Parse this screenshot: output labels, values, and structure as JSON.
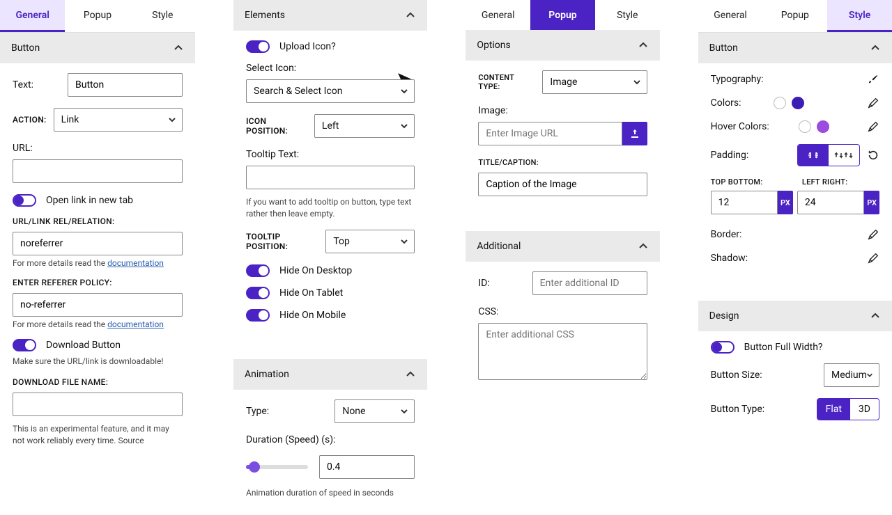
{
  "col1": {
    "tabs": {
      "general": "General",
      "popup": "Popup",
      "style": "Style"
    },
    "section_button": "Button",
    "text_label": "Text:",
    "text_value": "Button",
    "action_label": "ACTION:",
    "action_value": "Link",
    "url_label": "URL:",
    "url_value": "",
    "newtab_label": "Open link in new tab",
    "rel_label": "URL/LINK REL/RELATION:",
    "rel_value": "noreferrer",
    "rel_hint_pre": "For more details read the ",
    "rel_hint_link": "documentation",
    "refpol_label": "ENTER REFERER POLICY:",
    "refpol_value": "no-referrer",
    "refpol_hint_pre": "For more details read the ",
    "refpol_hint_link": "documentation",
    "download_label": "Download Button",
    "download_hint": "Make sure the URL/link is downloadable!",
    "dlfile_label": "DOWNLOAD FILE NAME:",
    "dlfile_value": "",
    "dlfile_hint_pre": "This is an experimental feature, and it may not work reliably every time. ",
    "dlfile_hint_link": "Source"
  },
  "col2": {
    "section_elements": "Elements",
    "upload_icon_label": "Upload Icon?",
    "select_icon_label": "Select Icon:",
    "select_icon_value": "Search & Select Icon",
    "icon_pos_label": "ICON POSITION:",
    "icon_pos_value": "Left",
    "tooltip_text_label": "Tooltip Text:",
    "tooltip_text_value": "",
    "tooltip_hint": "If you want to add tooltip on button, type text rather then leave empty.",
    "tooltip_pos_label": "TOOLTIP POSITION:",
    "tooltip_pos_value": "Top",
    "hide_desktop": "Hide On Desktop",
    "hide_tablet": "Hide On Tablet",
    "hide_mobile": "Hide On Mobile",
    "section_animation": "Animation",
    "anim_type_label": "Type:",
    "anim_type_value": "None",
    "anim_dur_label": "Duration (Speed) (s):",
    "anim_dur_value": "0.4",
    "anim_dur_hint": "Animation duration of speed in seconds"
  },
  "col3": {
    "tabs": {
      "general": "General",
      "popup": "Popup",
      "style": "Style"
    },
    "section_options": "Options",
    "content_type_label": "CONTENT TYPE:",
    "content_type_value": "Image",
    "image_label": "Image:",
    "image_placeholder": "Enter Image URL",
    "title_label": "TITLE/CAPTION:",
    "title_value": "Caption of the Image",
    "section_additional": "Additional",
    "id_label": "ID:",
    "id_placeholder": "Enter additional ID",
    "css_label": "CSS:",
    "css_placeholder": "Enter additional CSS"
  },
  "col4": {
    "tabs": {
      "general": "General",
      "popup": "Popup",
      "style": "Style"
    },
    "section_button": "Button",
    "typography_label": "Typography:",
    "colors_label": "Colors:",
    "hover_colors_label": "Hover Colors:",
    "colors_sw": [
      "#ffffff",
      "#3c1db5"
    ],
    "hover_sw": [
      "#ffffff",
      "#9b4de0"
    ],
    "padding_label": "Padding:",
    "tb_label": "TOP BOTTOM:",
    "lr_label": "LEFT RIGHT:",
    "tb_value": "12",
    "lr_value": "24",
    "px": "PX",
    "border_label": "Border:",
    "shadow_label": "Shadow:",
    "section_design": "Design",
    "fullwidth_label": "Button Full Width?",
    "size_label": "Button Size:",
    "size_value": "Medium",
    "type_label": "Button Type:",
    "type_opts": {
      "flat": "Flat",
      "threeD": "3D"
    }
  }
}
